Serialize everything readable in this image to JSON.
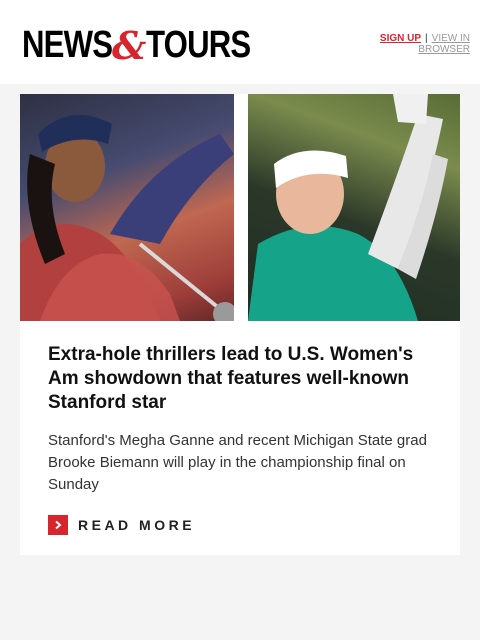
{
  "brand": {
    "logo_left": "NEWS",
    "logo_amp": "&",
    "logo_right": "TOURS",
    "accent_color": "#d6252c"
  },
  "topnav": {
    "signup": "SIGN UP",
    "separator": "|",
    "view_in_browser": "VIEW IN BROWSER"
  },
  "article": {
    "image_alt": "Megha Ganne and Brooke Biemann",
    "headline": "Extra-hole thrillers lead to U.S. Women's Am showdown that features well-known Stanford star",
    "summary": "Stanford's Megha Ganne and recent Michigan State grad Brooke Biemann will play in the championship final on Sunday",
    "cta_icon": "chevron-right-icon",
    "cta_label": "READ MORE"
  }
}
